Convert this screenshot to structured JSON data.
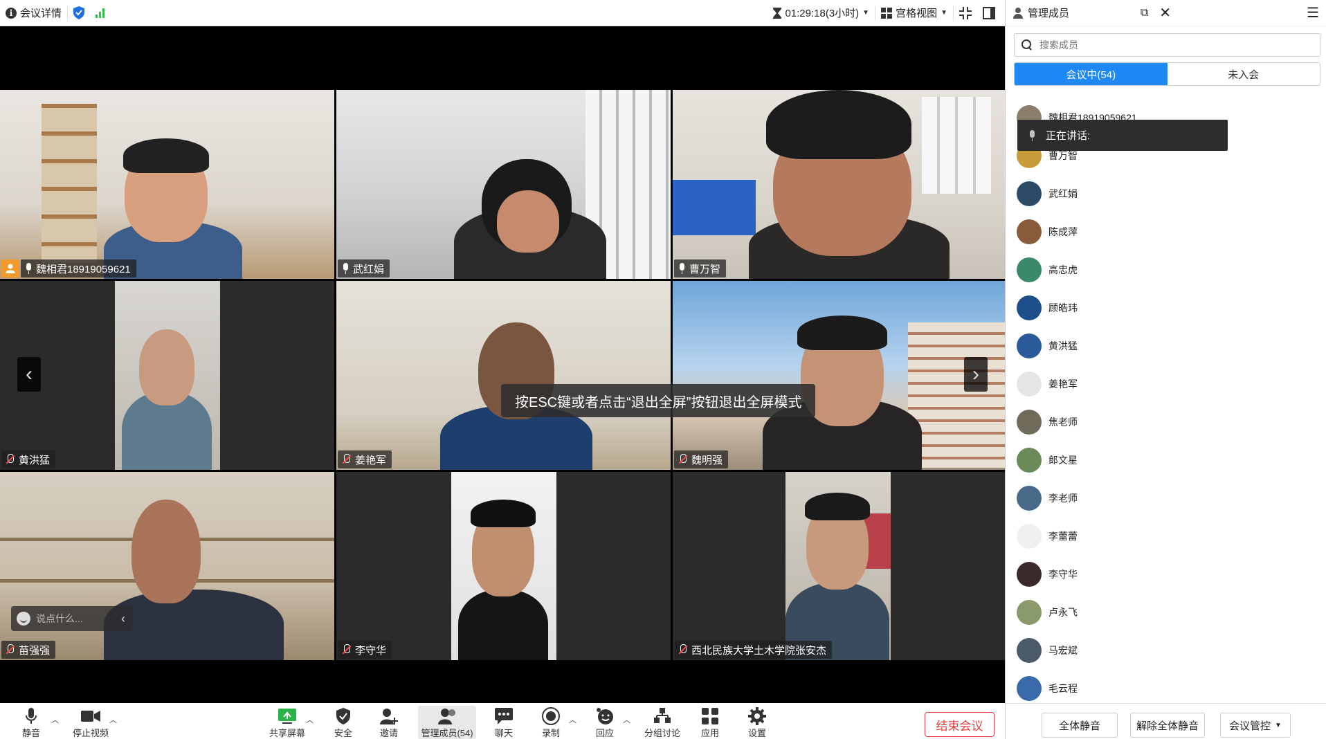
{
  "topbar": {
    "meeting_info": "会议详情",
    "timer": "01:29:18(3小时)",
    "view_mode": "宫格视图"
  },
  "video_tiles": [
    {
      "name": "魏相君18919059621",
      "mic": "on",
      "host": true
    },
    {
      "name": "武红娟",
      "mic": "on",
      "host": false
    },
    {
      "name": "曹万智",
      "mic": "on",
      "host": false
    },
    {
      "name": "黄洪猛",
      "mic": "muted",
      "host": false
    },
    {
      "name": "姜艳军",
      "mic": "muted",
      "host": false
    },
    {
      "name": "魏明强",
      "mic": "muted",
      "host": false
    },
    {
      "name": "苗强强",
      "mic": "muted",
      "host": false
    },
    {
      "name": "李守华",
      "mic": "muted",
      "host": false
    },
    {
      "name": "西北民族大学土木学院张安杰",
      "mic": "muted",
      "host": false
    }
  ],
  "toast": "按ESC键或者点击“退出全屏”按钮退出全屏模式",
  "chat_placeholder": "说点什么...",
  "toolbar": {
    "mute": "静音",
    "stop_video": "停止视频",
    "share_screen": "共享屏幕",
    "security": "安全",
    "invite": "邀请",
    "members": "管理成员(54)",
    "chat": "聊天",
    "record": "录制",
    "reaction": "回应",
    "breakout": "分组讨论",
    "apps": "应用",
    "settings": "设置",
    "end_meeting": "结束会议"
  },
  "panel": {
    "title": "管理成员",
    "search_placeholder": "搜索成员",
    "tab_in_meeting": "会议中(54)",
    "tab_not_joined": "未入会",
    "speaking_label": "正在讲话:",
    "members": [
      {
        "name": "魏相君18919059621",
        "mic": "on",
        "avatar_color": "#8a7f6a"
      },
      {
        "name": "曹万智",
        "mic": "on",
        "avatar_color": "#c79a3a"
      },
      {
        "name": "武红娟",
        "mic": "on",
        "avatar_color": "#2c4a66"
      },
      {
        "name": "陈成萍",
        "mic": "muted",
        "avatar_color": "#8a5b3b"
      },
      {
        "name": "高忠虎",
        "mic": "muted",
        "avatar_color": "#3a8a6a"
      },
      {
        "name": "顾皓玮",
        "mic": "muted",
        "avatar_color": "#1f4f8a"
      },
      {
        "name": "黄洪猛",
        "mic": "muted",
        "avatar_color": "#2a5a9a"
      },
      {
        "name": "姜艳军",
        "mic": "muted",
        "avatar_color": "#e5e5e5"
      },
      {
        "name": "焦老师",
        "mic": "muted",
        "avatar_color": "#6f6a5a"
      },
      {
        "name": "郎文星",
        "mic": "muted",
        "avatar_color": "#6a8a5a"
      },
      {
        "name": "李老师",
        "mic": "muted",
        "avatar_color": "#4a6a8a"
      },
      {
        "name": "李蕾蕾",
        "mic": "muted",
        "avatar_color": "#f0f0f0"
      },
      {
        "name": "李守华",
        "mic": "muted",
        "avatar_color": "#3a2a2a"
      },
      {
        "name": "卢永飞",
        "mic": "muted",
        "avatar_color": "#8a9a6a"
      },
      {
        "name": "马宏斌",
        "mic": "muted",
        "avatar_color": "#4a5a6a"
      },
      {
        "name": "毛云程",
        "mic": "muted",
        "avatar_color": "#3a6aaa"
      }
    ],
    "mute_all": "全体静音",
    "unmute_all": "解除全体静音",
    "meeting_control": "会议管控"
  },
  "colors": {
    "accent": "#1e88f5",
    "end_meeting": "#e53c3c",
    "host_badge": "#f39a2c"
  }
}
